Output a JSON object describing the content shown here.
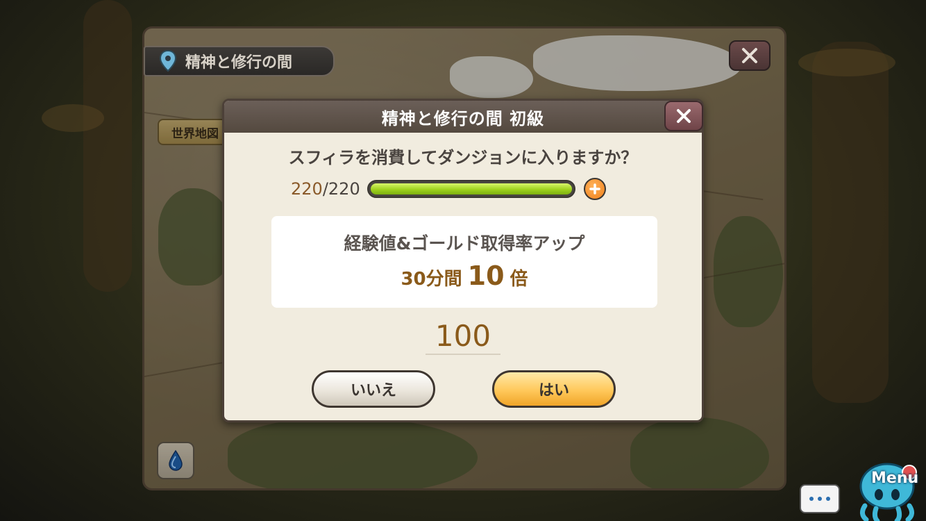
{
  "map": {
    "title": "精神と修行の間",
    "world_map_label": "世界地図"
  },
  "dialog": {
    "title": "精神と修行の間 初級",
    "question": "スフィラを消費してダンジョンに入りますか？",
    "stamina": {
      "current": "220",
      "separator": "/",
      "max": "220",
      "fill_fraction": 1.0
    },
    "bonus": {
      "title": "経験値&ゴールド取得率アップ",
      "duration": "30分間",
      "multiplier": "10",
      "multiplier_suffix": "倍"
    },
    "cost": "100",
    "no_label": "いいえ",
    "yes_label": "はい"
  },
  "widgets": {
    "menu_label": "Menu"
  },
  "colors": {
    "accent_gold": "#8a5a1a",
    "stamina_green": "#9fd21e",
    "yes_button": "#ffc85a"
  }
}
